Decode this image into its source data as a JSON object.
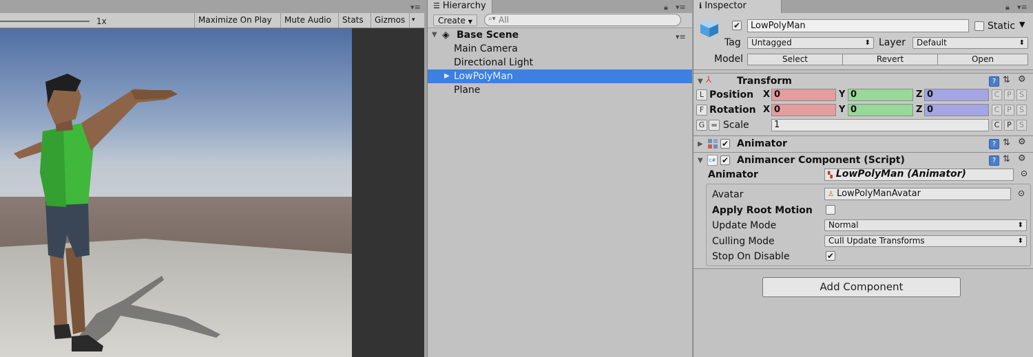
{
  "game": {
    "scale_label": "1x",
    "toolbar": [
      "Maximize On Play",
      "Mute Audio",
      "Stats",
      "Gizmos"
    ]
  },
  "hierarchy": {
    "tab": "Hierarchy",
    "create": "Create",
    "search_placeholder": "All",
    "scene": "Base Scene",
    "items": [
      "Main Camera",
      "Directional Light",
      "LowPolyMan",
      "Plane"
    ],
    "selected": "LowPolyMan"
  },
  "inspector": {
    "tab": "Inspector",
    "object_name": "LowPolyMan",
    "static_label": "Static",
    "tag_label": "Tag",
    "tag_value": "Untagged",
    "layer_label": "Layer",
    "layer_value": "Default",
    "model_label": "Model",
    "model_buttons": [
      "Select",
      "Revert",
      "Open"
    ],
    "transform": {
      "title": "Transform",
      "position": {
        "label": "Position",
        "x": "0",
        "y": "0",
        "z": "0",
        "btn": "L"
      },
      "rotation": {
        "label": "Rotation",
        "x": "0",
        "y": "0",
        "z": "0",
        "btn": "F"
      },
      "scale": {
        "label": "Scale",
        "value": "1",
        "btn": "G"
      },
      "cps": [
        "C",
        "P",
        "S"
      ]
    },
    "animator_title": "Animator",
    "animancer": {
      "title": "Animancer Component (Script)",
      "animator_label": "Animator",
      "animator_value": "LowPolyMan (Animator)",
      "avatar_label": "Avatar",
      "avatar_value": "LowPolyManAvatar",
      "root_motion_label": "Apply Root Motion",
      "update_mode_label": "Update Mode",
      "update_mode_value": "Normal",
      "culling_mode_label": "Culling Mode",
      "culling_mode_value": "Cull Update Transforms",
      "stop_label": "Stop On Disable"
    },
    "add_component": "Add Component"
  },
  "colors": {
    "selection": "#3d80df",
    "sky_top": "#5873a3",
    "ground": "#c9c7c1",
    "shirt": "#3fb83c"
  }
}
